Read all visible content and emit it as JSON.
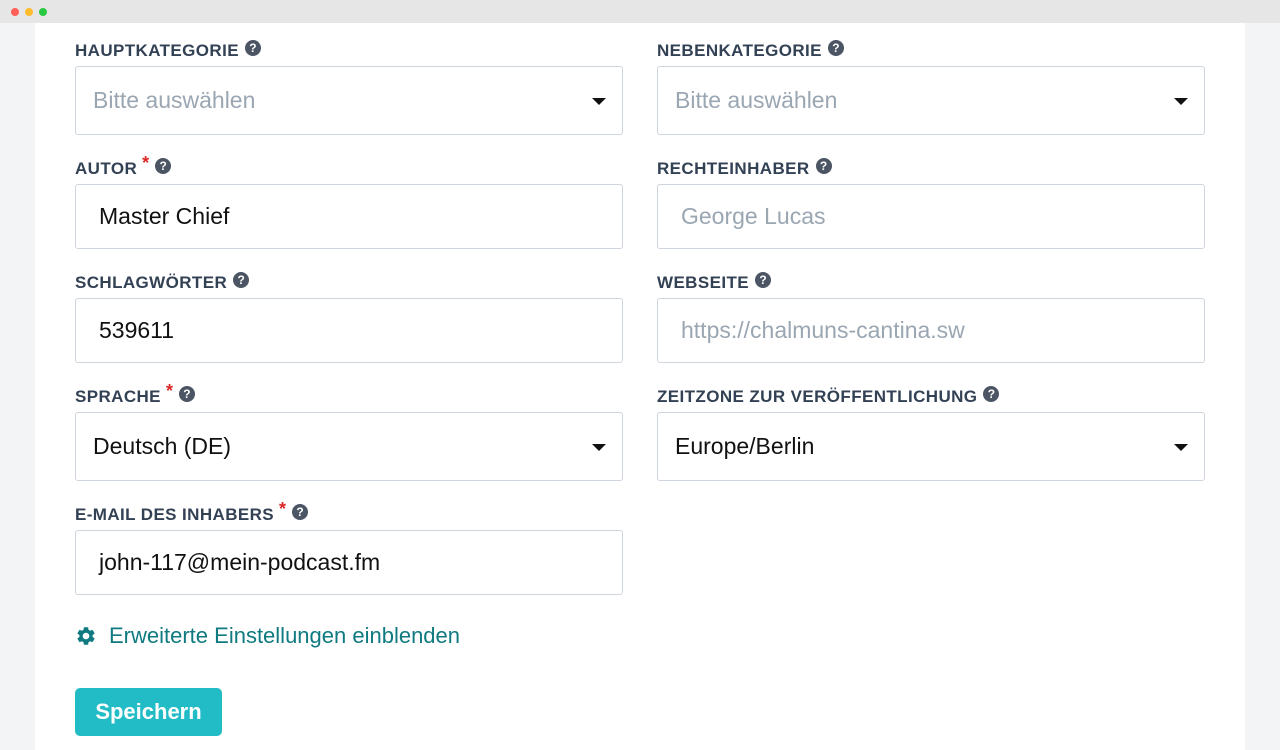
{
  "form": {
    "main_category": {
      "label": "HAUPTKATEGORIE",
      "placeholder": "Bitte auswählen"
    },
    "sub_category": {
      "label": "NEBENKATEGORIE",
      "placeholder": "Bitte auswählen"
    },
    "author": {
      "label": "AUTOR",
      "required_mark": "*",
      "value": "Master Chief"
    },
    "rights_holder": {
      "label": "RECHTEINHABER",
      "placeholder": "George Lucas"
    },
    "keywords": {
      "label": "SCHLAGWÖRTER",
      "value": "539611"
    },
    "website": {
      "label": "WEBSEITE",
      "placeholder": "https://chalmuns-cantina.sw"
    },
    "language": {
      "label": "SPRACHE",
      "required_mark": "*",
      "value": "Deutsch (DE)"
    },
    "timezone": {
      "label": "ZEITZONE ZUR VERÖFFENTLICHUNG",
      "value": "Europe/Berlin"
    },
    "owner_email": {
      "label": "E-MAIL DES INHABERS",
      "required_mark": "*",
      "value": "john-117@mein-podcast.fm"
    },
    "help_glyph": "?"
  },
  "advanced_toggle": {
    "label": "Erweiterte Einstellungen einblenden",
    "icon": "gear-icon"
  },
  "save_button": {
    "label": "Speichern"
  },
  "colors": {
    "accent": "#22bcc6",
    "link": "#0f7a80",
    "required": "#dc2626"
  }
}
